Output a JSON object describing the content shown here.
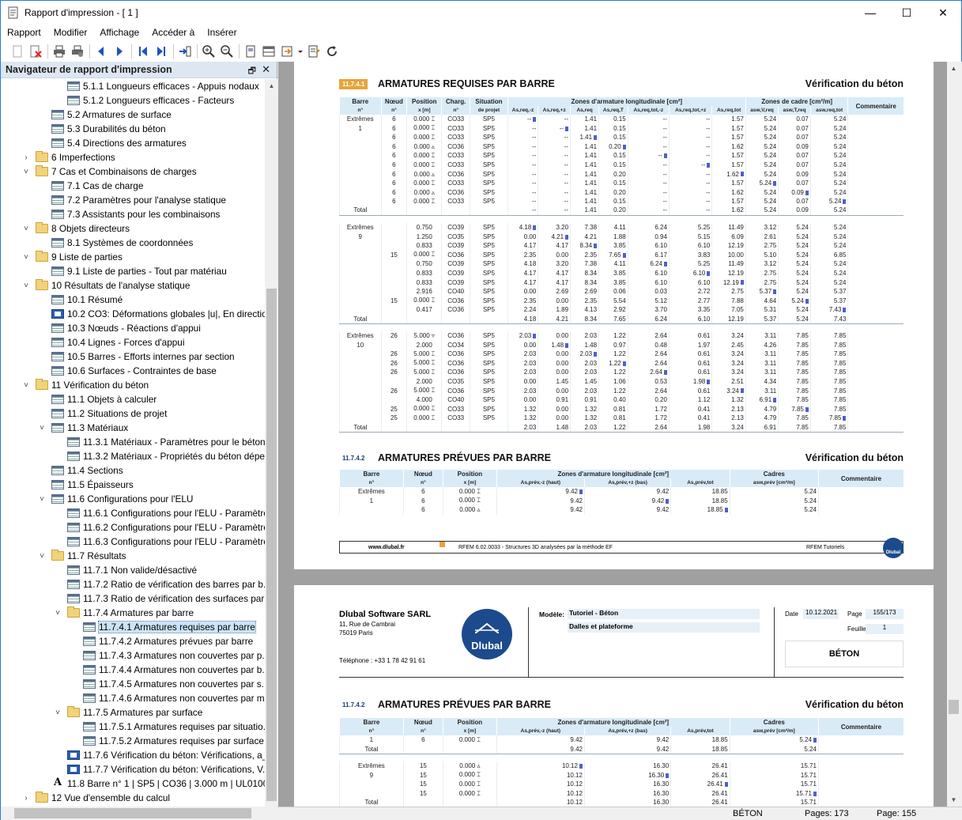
{
  "window": {
    "title": "Rapport d'impression - [ 1 ]",
    "min": "—",
    "max": "☐",
    "close": "✕"
  },
  "menu": [
    "Rapport",
    "Modifier",
    "Affichage",
    "Accéder à",
    "Insérer"
  ],
  "nav": {
    "title": "Navigateur de rapport d'impression",
    "pin": "🗗",
    "close": "✕",
    "items": [
      {
        "t": "5.1.1 Longueurs efficaces - Appuis nodaux",
        "lvl": 4,
        "ic": "table"
      },
      {
        "t": "5.1.2 Longueurs efficaces - Facteurs",
        "lvl": 4,
        "ic": "table"
      },
      {
        "t": "5.2 Armatures de surface",
        "lvl": 3,
        "ic": "table"
      },
      {
        "t": "5.3 Durabilités du béton",
        "lvl": 3,
        "ic": "table"
      },
      {
        "t": "5.4 Directions des armatures",
        "lvl": 3,
        "ic": "table"
      },
      {
        "t": "6 Imperfections",
        "lvl": 2,
        "ic": "folder",
        "ch": "›"
      },
      {
        "t": "7 Cas et Combinaisons de charges",
        "lvl": 2,
        "ic": "folder",
        "ch": "˅"
      },
      {
        "t": "7.1 Cas de charge",
        "lvl": 3,
        "ic": "table"
      },
      {
        "t": "7.2 Paramètres pour l'analyse statique",
        "lvl": 3,
        "ic": "table"
      },
      {
        "t": "7.3 Assistants pour les combinaisons",
        "lvl": 3,
        "ic": "table"
      },
      {
        "t": "8 Objets directeurs",
        "lvl": 2,
        "ic": "folder",
        "ch": "˅"
      },
      {
        "t": "8.1 Systèmes de coordonnées",
        "lvl": 3,
        "ic": "table"
      },
      {
        "t": "9 Liste de parties",
        "lvl": 2,
        "ic": "folder",
        "ch": "˅"
      },
      {
        "t": "9.1 Liste de parties - Tout par matériau",
        "lvl": 3,
        "ic": "table"
      },
      {
        "t": "10 Résultats de l'analyse statique",
        "lvl": 2,
        "ic": "folder",
        "ch": "˅"
      },
      {
        "t": "10.1 Résumé",
        "lvl": 3,
        "ic": "table"
      },
      {
        "t": "10.2 CO3: Déformations globales |u|, En directio...",
        "lvl": 3,
        "ic": "graph"
      },
      {
        "t": "10.3 Nœuds - Réactions d'appui",
        "lvl": 3,
        "ic": "table"
      },
      {
        "t": "10.4 Lignes - Forces d'appui",
        "lvl": 3,
        "ic": "table"
      },
      {
        "t": "10.5 Barres - Efforts internes par section",
        "lvl": 3,
        "ic": "table"
      },
      {
        "t": "10.6 Surfaces - Contraintes de base",
        "lvl": 3,
        "ic": "table"
      },
      {
        "t": "11 Vérification du béton",
        "lvl": 2,
        "ic": "folder",
        "ch": "˅"
      },
      {
        "t": "11.1 Objets à calculer",
        "lvl": 3,
        "ic": "table"
      },
      {
        "t": "11.2 Situations de projet",
        "lvl": 3,
        "ic": "table"
      },
      {
        "t": "11.3 Matériaux",
        "lvl": 3,
        "ic": "table",
        "ch": "˅"
      },
      {
        "t": "11.3.1 Matériaux - Paramètres pour le béton",
        "lvl": 4,
        "ic": "table"
      },
      {
        "t": "11.3.2 Matériaux - Propriétés du béton dépe...",
        "lvl": 4,
        "ic": "table"
      },
      {
        "t": "11.4 Sections",
        "lvl": 3,
        "ic": "table"
      },
      {
        "t": "11.5 Épaisseurs",
        "lvl": 3,
        "ic": "table"
      },
      {
        "t": "11.6 Configurations pour l'ELU",
        "lvl": 3,
        "ic": "table",
        "ch": "˅"
      },
      {
        "t": "11.6.1 Configurations pour l'ELU - Paramètre...",
        "lvl": 4,
        "ic": "table"
      },
      {
        "t": "11.6.2 Configurations pour l'ELU - Paramètre...",
        "lvl": 4,
        "ic": "table"
      },
      {
        "t": "11.6.3 Configurations pour l'ELU - Paramètre...",
        "lvl": 4,
        "ic": "table"
      },
      {
        "t": "11.7 Résultats",
        "lvl": 3,
        "ic": "folder",
        "ch": "˅"
      },
      {
        "t": "11.7.1 Non valide/désactivé",
        "lvl": 4,
        "ic": "table"
      },
      {
        "t": "11.7.2 Ratio de vérification des barres par b...",
        "lvl": 4,
        "ic": "table"
      },
      {
        "t": "11.7.3 Ratio de vérification des surfaces par ...",
        "lvl": 4,
        "ic": "table"
      },
      {
        "t": "11.7.4 Armatures par barre",
        "lvl": 4,
        "ic": "folder",
        "ch": "˅"
      },
      {
        "t": "11.7.4.1 Armatures requises par barre",
        "lvl": 5,
        "ic": "table",
        "sel": true
      },
      {
        "t": "11.7.4.2 Armatures prévues par barre",
        "lvl": 5,
        "ic": "table"
      },
      {
        "t": "11.7.4.3 Armatures non couvertes par p...",
        "lvl": 5,
        "ic": "table"
      },
      {
        "t": "11.7.4.4 Armatures non couvertes par b...",
        "lvl": 5,
        "ic": "table"
      },
      {
        "t": "11.7.4.5 Armatures non couvertes par s...",
        "lvl": 5,
        "ic": "table"
      },
      {
        "t": "11.7.4.6 Armatures non couvertes par m...",
        "lvl": 5,
        "ic": "table"
      },
      {
        "t": "11.7.5 Armatures par surface",
        "lvl": 4,
        "ic": "folder",
        "ch": "˅"
      },
      {
        "t": "11.7.5.1 Armatures requises par situatio...",
        "lvl": 5,
        "ic": "table"
      },
      {
        "t": "11.7.5.2 Armatures requises par surface",
        "lvl": 5,
        "ic": "table"
      },
      {
        "t": "11.7.6 Vérification du béton: Vérifications, a_s...",
        "lvl": 4,
        "ic": "graph"
      },
      {
        "t": "11.7.7 Vérification du béton: Vérifications, V...",
        "lvl": 4,
        "ic": "graph"
      },
      {
        "t": "11.8 Barre n° 1 | SP5 | CO36 | 3.000 m | UL0100",
        "lvl": 3,
        "ic": "text"
      },
      {
        "t": "12 Vue d'ensemble du calcul",
        "lvl": 2,
        "ic": "folder",
        "ch": "›"
      }
    ]
  },
  "page1": {
    "sec1": {
      "num": "11.7.4.1",
      "title": "ARMATURES REQUISES PAR BARRE",
      "right": "Vérification du béton"
    },
    "h1": [
      "Barre",
      "Nœud",
      "Position",
      "Charg.",
      "Situation",
      "",
      "Zones d'armature longitudinale [cm²]",
      "",
      "",
      "",
      "",
      "",
      "",
      "Zones de cadre [cm²/m]",
      "",
      "",
      "Commentaire"
    ],
    "h2": [
      "n°",
      "n°",
      "x [m]",
      "n°",
      "de projet",
      "As,req,-z",
      "As,req,+z",
      "As,req",
      "As,req,T",
      "As,req,tot,-z",
      "As,req,tot,+z",
      "As,req,tot",
      "asw,V,req",
      "asw,T,req",
      "asw,req,tot",
      ""
    ],
    "rows": [
      [
        "Extrêmes",
        "6",
        "0.000 ⌶",
        "CO33",
        "SP5",
        "-- ▪",
        "--",
        "1.41",
        "0.15",
        "--",
        "--",
        "1.57",
        "5.24",
        "0.07",
        "5.24",
        ""
      ],
      [
        "1",
        "6",
        "0.000 ⌶",
        "CO33",
        "SP5",
        "--",
        "-- ▪",
        "1.41",
        "0.15",
        "--",
        "--",
        "1.57",
        "5.24",
        "0.07",
        "5.24",
        ""
      ],
      [
        "",
        "6",
        "0.000 ⌶",
        "CO33",
        "SP5",
        "--",
        "--",
        "1.41 ▪",
        "0.15",
        "--",
        "--",
        "1.57",
        "5.24",
        "0.07",
        "5.24",
        ""
      ],
      [
        "",
        "6",
        "0.000 ▵",
        "CO36",
        "SP5",
        "--",
        "--",
        "1.41",
        "0.20 ▪",
        "--",
        "--",
        "1.62",
        "5.24",
        "0.09",
        "5.24",
        ""
      ],
      [
        "",
        "6",
        "0.000 ⌶",
        "CO33",
        "SP5",
        "--",
        "--",
        "1.41",
        "0.15",
        "-- ▪",
        "--",
        "1.57",
        "5.24",
        "0.07",
        "5.24",
        ""
      ],
      [
        "",
        "6",
        "0.000 ⌶",
        "CO33",
        "SP5",
        "--",
        "--",
        "1.41",
        "0.15",
        "--",
        "-- ▪",
        "1.57",
        "5.24",
        "0.07",
        "5.24",
        ""
      ],
      [
        "",
        "6",
        "0.000 ▵",
        "CO36",
        "SP5",
        "--",
        "--",
        "1.41",
        "0.20",
        "--",
        "--",
        "1.62 ▪",
        "5.24",
        "0.09",
        "5.24",
        ""
      ],
      [
        "",
        "6",
        "0.000 ⌶",
        "CO33",
        "SP5",
        "--",
        "--",
        "1.41",
        "0.15",
        "--",
        "--",
        "1.57",
        "5.24 ▪",
        "0.07",
        "5.24",
        ""
      ],
      [
        "",
        "6",
        "0.000 ▵",
        "CO36",
        "SP5",
        "--",
        "--",
        "1.41",
        "0.20",
        "--",
        "--",
        "1.62",
        "5.24",
        "0.09 ▪",
        "5.24",
        ""
      ],
      [
        "",
        "6",
        "0.000 ⌶",
        "CO33",
        "SP5",
        "--",
        "--",
        "1.41",
        "0.15",
        "--",
        "--",
        "1.57",
        "5.24",
        "0.07",
        "5.24 ▪",
        ""
      ],
      [
        "Total",
        "",
        "",
        "",
        "",
        "--",
        "--",
        "1.41",
        "0.20",
        "--",
        "--",
        "1.62",
        "5.24",
        "0.09",
        "5.24",
        ""
      ],
      [
        "gap"
      ],
      [
        "Extrêmes",
        "",
        "0.750",
        "CO39",
        "SP5",
        "4.18 ▪",
        "3.20",
        "7.38",
        "4.11",
        "6.24",
        "5.25",
        "11.49",
        "3.12",
        "5.24",
        "5.24",
        ""
      ],
      [
        "9",
        "",
        "1.250",
        "CO35",
        "SP5",
        "0.00",
        "4.21 ▪",
        "4.21",
        "1.88",
        "0.94",
        "5.15",
        "6.09",
        "2.61",
        "5.24",
        "5.24",
        ""
      ],
      [
        "",
        "",
        "0.833",
        "CO39",
        "SP5",
        "4.17",
        "4.17",
        "8.34 ▪",
        "3.85",
        "6.10",
        "6.10",
        "12.19",
        "2.75",
        "5.24",
        "5.24",
        ""
      ],
      [
        "",
        "15",
        "0.000 ⌶",
        "CO36",
        "SP5",
        "2.35",
        "0.00",
        "2.35",
        "7.65 ▪",
        "6.17",
        "3.83",
        "10.00",
        "5.10",
        "5.24",
        "6.85",
        ""
      ],
      [
        "",
        "",
        "0.750",
        "CO39",
        "SP5",
        "4.18",
        "3.20",
        "7.38",
        "4.11",
        "6.24 ▪",
        "5.25",
        "11.49",
        "3.12",
        "5.24",
        "5.24",
        ""
      ],
      [
        "",
        "",
        "0.833",
        "CO39",
        "SP5",
        "4.17",
        "4.17",
        "8.34",
        "3.85",
        "6.10",
        "6.10 ▪",
        "12.19",
        "2.75",
        "5.24",
        "5.24",
        ""
      ],
      [
        "",
        "",
        "0.833",
        "CO39",
        "SP5",
        "4.17",
        "4.17",
        "8.34",
        "3.85",
        "6.10",
        "6.10",
        "12.19 ▪",
        "2.75",
        "5.24",
        "5.24",
        ""
      ],
      [
        "",
        "",
        "2.916",
        "CO40",
        "SP5",
        "0.00",
        "2.69",
        "2.69",
        "0.06",
        "0.03",
        "2.72",
        "2.75",
        "5.37 ▪",
        "5.24",
        "5.37",
        ""
      ],
      [
        "",
        "15",
        "0.000 ⌶",
        "CO36",
        "SP5",
        "2.35",
        "0.00",
        "2.35",
        "5.54",
        "5.12",
        "2.77",
        "7.88",
        "4.64",
        "5.24 ▪",
        "5.37",
        ""
      ],
      [
        "",
        "",
        "0.417",
        "CO36",
        "SP5",
        "2.24",
        "1.89",
        "4.13",
        "2.92",
        "3.70",
        "3.35",
        "7.05",
        "5.31",
        "5.24",
        "7.43 ▪",
        ""
      ],
      [
        "Total",
        "",
        "",
        "",
        "",
        "4.18",
        "4.21",
        "8.34",
        "7.65",
        "6.24",
        "6.10",
        "12.19",
        "5.37",
        "5.24",
        "7.43",
        ""
      ],
      [
        "gap"
      ],
      [
        "Extrêmes",
        "26",
        "5.000 ▿",
        "CO36",
        "SP5",
        "2.03 ▪",
        "0.00",
        "2.03",
        "1.22",
        "2.64",
        "0.61",
        "3.24",
        "3.11",
        "7.85",
        "7.85",
        ""
      ],
      [
        "10",
        "",
        "2.000",
        "CO34",
        "SP5",
        "0.00",
        "1.48 ▪",
        "1.48",
        "0.97",
        "0.48",
        "1.97",
        "2.45",
        "4.26",
        "7.85",
        "7.85",
        ""
      ],
      [
        "",
        "26",
        "5.000 ⌶",
        "CO36",
        "SP5",
        "2.03",
        "0.00",
        "2.03 ▪",
        "1.22",
        "2.64",
        "0.61",
        "3.24",
        "3.11",
        "7.85",
        "7.85",
        ""
      ],
      [
        "",
        "26",
        "5.000 ⌶",
        "CO36",
        "SP5",
        "2.03",
        "0.00",
        "2.03",
        "1.22 ▪",
        "2.64",
        "0.61",
        "3.24",
        "3.11",
        "7.85",
        "7.85",
        ""
      ],
      [
        "",
        "26",
        "5.000 ⌶",
        "CO36",
        "SP5",
        "2.03",
        "0.00",
        "2.03",
        "1.22",
        "2.64 ▪",
        "0.61",
        "3.24",
        "3.11",
        "7.85",
        "7.85",
        ""
      ],
      [
        "",
        "",
        "2.000",
        "CO35",
        "SP5",
        "0.00",
        "1.45",
        "1.45",
        "1.06",
        "0.53",
        "1.98 ▪",
        "2.51",
        "4.34",
        "7.85",
        "7.85",
        ""
      ],
      [
        "",
        "26",
        "5.000 ⌶",
        "CO36",
        "SP5",
        "2.03",
        "0.00",
        "2.03",
        "1.22",
        "2.64",
        "0.61",
        "3.24 ▪",
        "3.11",
        "7.85",
        "7.85",
        ""
      ],
      [
        "",
        "",
        "4.000",
        "CO40",
        "SP5",
        "0.00",
        "0.91",
        "0.91",
        "0.40",
        "0.20",
        "1.12",
        "1.32",
        "6.91 ▪",
        "7.85",
        "7.85",
        ""
      ],
      [
        "",
        "25",
        "0.000 ⌶",
        "CO33",
        "SP5",
        "1.32",
        "0.00",
        "1.32",
        "0.81",
        "1.72",
        "0.41",
        "2.13",
        "4.79",
        "7.85 ▪",
        "7.85",
        ""
      ],
      [
        "",
        "25",
        "0.000 ⌶",
        "CO33",
        "SP5",
        "1.32",
        "0.00",
        "1.32",
        "0.81",
        "1.72",
        "0.41",
        "2.13",
        "4.79",
        "7.85",
        "7.85 ▪",
        ""
      ],
      [
        "Total",
        "",
        "",
        "",
        "",
        "2.03",
        "1.48",
        "2.03",
        "1.22",
        "2.64",
        "1.98",
        "3.24",
        "6.91",
        "7.85",
        "7.85",
        ""
      ]
    ],
    "sec2": {
      "num": "11.7.4.2",
      "title": "ARMATURES PRÉVUES PAR BARRE",
      "right": "Vérification du béton"
    },
    "p_h1": [
      "Barre",
      "Nœud",
      "Position",
      "Zones d'armature longitudinale [cm²]",
      "",
      "",
      "Cadres",
      "Commentaire"
    ],
    "p_h2": [
      "n°",
      "n°",
      "x [m]",
      "As,prév,-z (haut)",
      "As,prév,+z (bas)",
      "As,prév,tot",
      "asw,prév [cm²/m]",
      ""
    ],
    "p_rows": [
      [
        "Extrêmes",
        "6",
        "0.000 ⌶",
        "9.42 ▪",
        "9.42",
        "18.85",
        "5.24",
        ""
      ],
      [
        "1",
        "6",
        "0.000 ⌶",
        "9.42",
        "9.42 ▪",
        "18.85",
        "5.24",
        ""
      ],
      [
        "",
        "6",
        "0.000 ▵",
        "9.42",
        "9.42",
        "18.85 ▪",
        "5.24",
        ""
      ]
    ],
    "footer": {
      "url": "www.dlubal.fr",
      "soft": "RFEM 6.02.0033 - Structures 3D analysées par la méthode EF",
      "right": "RFEM Tutoriels",
      "logo": "Dlubal"
    }
  },
  "page2": {
    "company": "Dlubal Software SARL",
    "addr1": "11, Rue de Cambrai",
    "addr2": "75019 Paris",
    "phone": "Téléphone : +33 1 78 42 91 61",
    "logo": "Dlubal",
    "model_label": "Modèle:",
    "model": "Tutoriel - Béton",
    "model2": "Dalles et plateforme",
    "date_label": "Date",
    "date": "10.12.2021",
    "page_label": "Page",
    "page": "155/173",
    "sheet_label": "Feuille",
    "sheet": "1",
    "section": "BÉTON",
    "sec": {
      "num": "11.7.4.2",
      "title": "ARMATURES PRÉVUES PAR BARRE",
      "right": "Vérification du béton"
    },
    "rows": [
      [
        "1",
        "6",
        "0.000 ⌶",
        "9.42",
        "9.42",
        "18.85",
        "5.24 ▪",
        ""
      ],
      [
        "Total",
        "",
        "",
        "9.42",
        "9.42",
        "18.85",
        "5.24",
        ""
      ],
      [
        "gap"
      ],
      [
        "Extrêmes",
        "15",
        "0.000 ▵",
        "10.12 ▪",
        "16.30",
        "26.41",
        "15.71",
        ""
      ],
      [
        "9",
        "15",
        "0.000 ⌶",
        "10.12",
        "16.30 ▪",
        "26.41",
        "15.71",
        ""
      ],
      [
        "",
        "15",
        "0.000 ⌶",
        "10.12",
        "16.30",
        "26.41 ▪",
        "15.71",
        ""
      ],
      [
        "",
        "15",
        "0.000 ⌶",
        "10.12",
        "16.30",
        "26.41",
        "15.71 ▪",
        ""
      ],
      [
        "Total",
        "",
        "",
        "10.12",
        "16.30",
        "26.41",
        "15.71",
        ""
      ]
    ]
  },
  "status": {
    "section": "BÉTON",
    "pages": "Pages: 173",
    "page": "Page: 155"
  }
}
